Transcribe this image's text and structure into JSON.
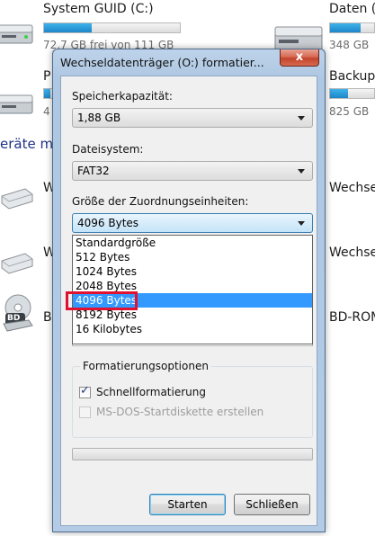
{
  "background": {
    "drive1": {
      "label": "System GUID (C:)",
      "sub": "72,7 GB frei von 111 GB",
      "fill_fraction": 0.35
    },
    "drive2": {
      "label": "Daten (",
      "sub": "348 GB",
      "fill_fraction": 0.7
    },
    "drive3": {
      "label": "P",
      "sub": "4",
      "fill_fraction": 0.4
    },
    "drive4": {
      "label": "Backup",
      "sub": "825 GB",
      "fill_fraction": 0.4
    },
    "section_heading": "eräte m",
    "item_w1": "W",
    "item_w2": "Wechse",
    "item_w3": "W",
    "item_w4": "Wechse",
    "item_b1": "B",
    "item_bd": "BD-ROM",
    "bd_badge": "BD"
  },
  "dialog": {
    "title": "Wechseldatenträger (O:) formatier...",
    "close_label": "x",
    "capacity_label": "Speicherkapazität:",
    "capacity_value": "1,88 GB",
    "filesystem_label": "Dateisystem:",
    "filesystem_value": "FAT32",
    "allocation_label": "Größe der Zuordnungseinheiten:",
    "allocation_value": "4096 Bytes",
    "allocation_options": [
      "Standardgröße",
      "512 Bytes",
      "1024 Bytes",
      "2048 Bytes",
      "4096 Bytes",
      "8192 Bytes",
      "16 Kilobytes"
    ],
    "allocation_selected_index": 4,
    "options_group_title": "Formatierungsoptionen",
    "quick_format_label": "Schnellformatierung",
    "quick_format_checked": true,
    "msdos_label": "MS-DOS-Startdiskette erstellen",
    "msdos_checked": false,
    "start_button": "Starten",
    "close_button": "Schließen"
  },
  "colors": {
    "accent": "#3399ff",
    "highlight_box": "#e0122f",
    "close_button": "#c3432b"
  }
}
